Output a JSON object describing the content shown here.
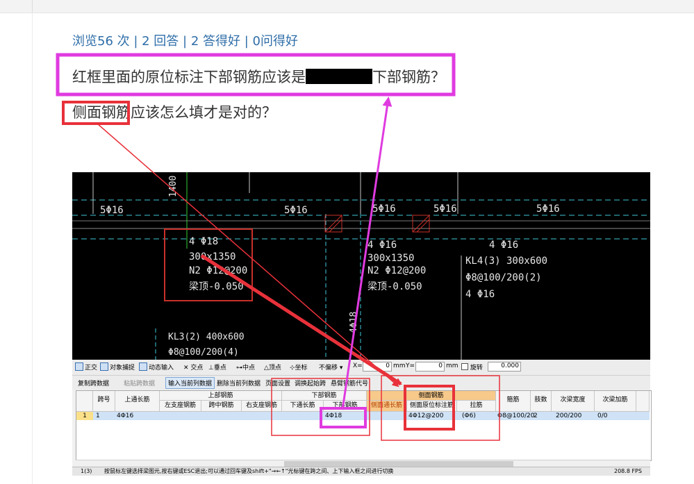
{
  "page": {
    "stats": "浏览56 次 | 2 回答 | 2 答得好 | 0问得好",
    "question_line1_before": "红框里面的原位标注下部钢筋应该是",
    "question_line1_after": "下部钢筋？",
    "question_line2": "侧面钢筋应该怎么填才是对的？"
  },
  "colors": {
    "link": "#2f6ea8",
    "annotation_red": "#e8313a",
    "annotation_magenta": "#e03be0",
    "cad_line_cyan": "#3fc9d8",
    "cad_box_red": "#c8302a"
  },
  "cad": {
    "beam_labels": [
      {
        "text": "5Φ16"
      },
      {
        "text": "5Φ16"
      },
      {
        "text": "5Φ16"
      },
      {
        "text": "5Φ16"
      },
      {
        "text": "5Φ16"
      }
    ],
    "note1": [
      "4 Φ18",
      "300x1350",
      "N2 Φ12@200",
      "梁顶-0.050"
    ],
    "note2": [
      "4 Φ16",
      "300x1350",
      "N2 Φ12@200",
      "梁顶-0.050"
    ],
    "note3": [
      "4 Φ16",
      "KL4(3) 300x600",
      "Φ8@100/200(2)",
      "4 Φ16"
    ],
    "kl3": [
      "KL3(2) 400x600",
      "Φ8@100/200(4)"
    ],
    "vertical_labels": [
      "1400",
      "4Φ18"
    ]
  },
  "toolbar1": {
    "items": [
      "正交",
      "对象捕捉",
      "动态输入",
      "交点",
      "垂点",
      "中点",
      "顶点",
      "坐标",
      "不偏移"
    ],
    "x_label": "X=",
    "x_value": "0",
    "unit1": "mm",
    "y_label": "Y=",
    "y_value": "0",
    "unit2": "mm",
    "rotate_label": "旋转",
    "rotate_value": "0.000"
  },
  "toolbar2": {
    "items": [
      "复制跨数据",
      "粘贴跨数据",
      "输入当前列数据",
      "删除当前列数据",
      "页面设置",
      "调换起始跨",
      "悬臂钢筋代号"
    ]
  },
  "table": {
    "group_headers": [
      "上部钢筋",
      "下部钢筋",
      "侧面钢筋"
    ],
    "headers": [
      "跨号",
      "上通长筋",
      "左支座钢筋",
      "跨中钢筋",
      "右支座钢筋",
      "下通长筋",
      "下部钢筋",
      "侧面通长筋",
      "侧面原位标注筋",
      "拉筋",
      "箍筋",
      "肢数",
      "次梁宽度",
      "次梁加筋"
    ],
    "row": {
      "index": "1",
      "span": "1",
      "top_long": "4Φ16",
      "bottom_rebar": "4Φ18",
      "side_orig": "4Φ12@200",
      "tie": "(Φ6)",
      "stirrup": "Φ8@100/20",
      "legs": "2",
      "secondary_width": "200/200",
      "secondary_add": "0/0"
    }
  },
  "status": {
    "left": "1(3)",
    "message": "按鼠标左键选择梁图元,按右键或ESC退出;可以通过回车键及shift+\"→←↑\"光标键在跨之间、上下输入框之间进行切换",
    "fps": "208.8 FPS"
  }
}
